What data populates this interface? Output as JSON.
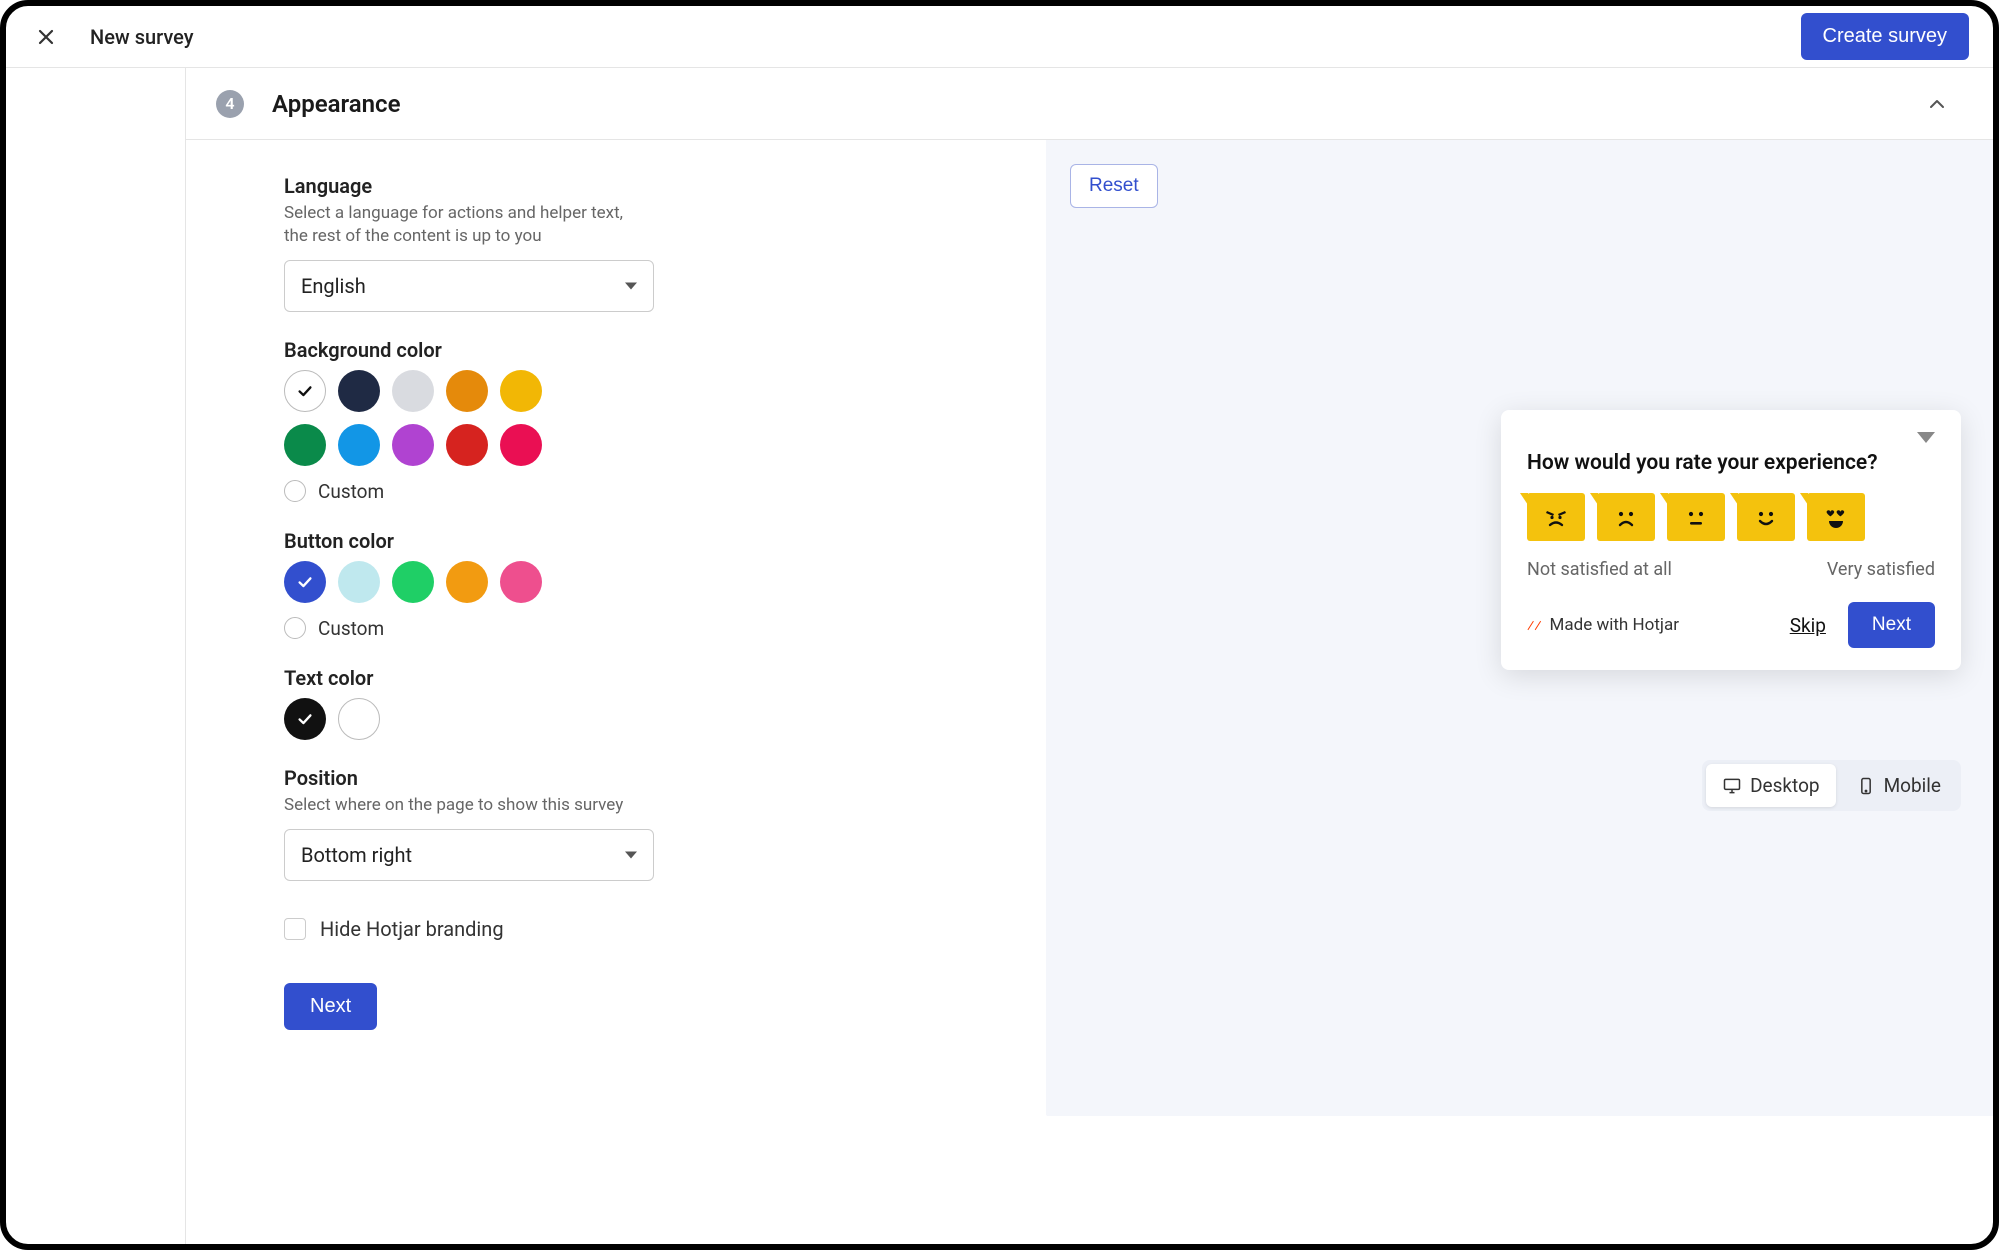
{
  "topbar": {
    "title": "New survey",
    "create_button": "Create survey"
  },
  "section": {
    "step_number": "4",
    "title": "Appearance"
  },
  "form": {
    "language": {
      "label": "Language",
      "help": "Select a language for actions and helper text, the rest of the content is up to you",
      "value": "English"
    },
    "background_color": {
      "label": "Background color",
      "swatches": [
        {
          "name": "white",
          "hex": "#ffffff",
          "selected": true,
          "bordered": true
        },
        {
          "name": "navy",
          "hex": "#1f2a44",
          "selected": false
        },
        {
          "name": "light-gray",
          "hex": "#d9dbe0",
          "selected": false
        },
        {
          "name": "orange",
          "hex": "#e58a0b",
          "selected": false
        },
        {
          "name": "amber",
          "hex": "#f2b705",
          "selected": false
        },
        {
          "name": "green",
          "hex": "#0a8a4a",
          "selected": false
        },
        {
          "name": "blue",
          "hex": "#1296e6",
          "selected": false
        },
        {
          "name": "purple",
          "hex": "#b043d1",
          "selected": false
        },
        {
          "name": "red",
          "hex": "#d6231f",
          "selected": false
        },
        {
          "name": "pink-red",
          "hex": "#ea0f53",
          "selected": false
        }
      ],
      "custom_label": "Custom"
    },
    "button_color": {
      "label": "Button color",
      "swatches": [
        {
          "name": "indigo",
          "hex": "#324fce",
          "selected": true,
          "dark": true
        },
        {
          "name": "light-cyan",
          "hex": "#bfe8ee",
          "selected": false
        },
        {
          "name": "green",
          "hex": "#1fcf66",
          "selected": false
        },
        {
          "name": "orange",
          "hex": "#f29b11",
          "selected": false
        },
        {
          "name": "pink",
          "hex": "#ee4f8e",
          "selected": false
        }
      ],
      "custom_label": "Custom"
    },
    "text_color": {
      "label": "Text color",
      "swatches": [
        {
          "name": "black",
          "hex": "#111111",
          "selected": true,
          "dark": true
        },
        {
          "name": "white",
          "hex": "#ffffff",
          "selected": false,
          "bordered": true
        }
      ]
    },
    "position": {
      "label": "Position",
      "help": "Select where on the page to show this survey",
      "value": "Bottom right"
    },
    "hide_branding": {
      "label": "Hide Hotjar branding",
      "checked": false
    },
    "next_button": "Next"
  },
  "preview": {
    "reset_button": "Reset",
    "question": "How would you rate your experience?",
    "emoji_ratings": [
      "angry",
      "sad",
      "neutral",
      "happy",
      "love"
    ],
    "low_label": "Not satisfied at all",
    "high_label": "Very satisfied",
    "branding": "Made with Hotjar",
    "skip": "Skip",
    "next": "Next",
    "device": {
      "desktop": "Desktop",
      "mobile": "Mobile",
      "active": "desktop"
    }
  }
}
